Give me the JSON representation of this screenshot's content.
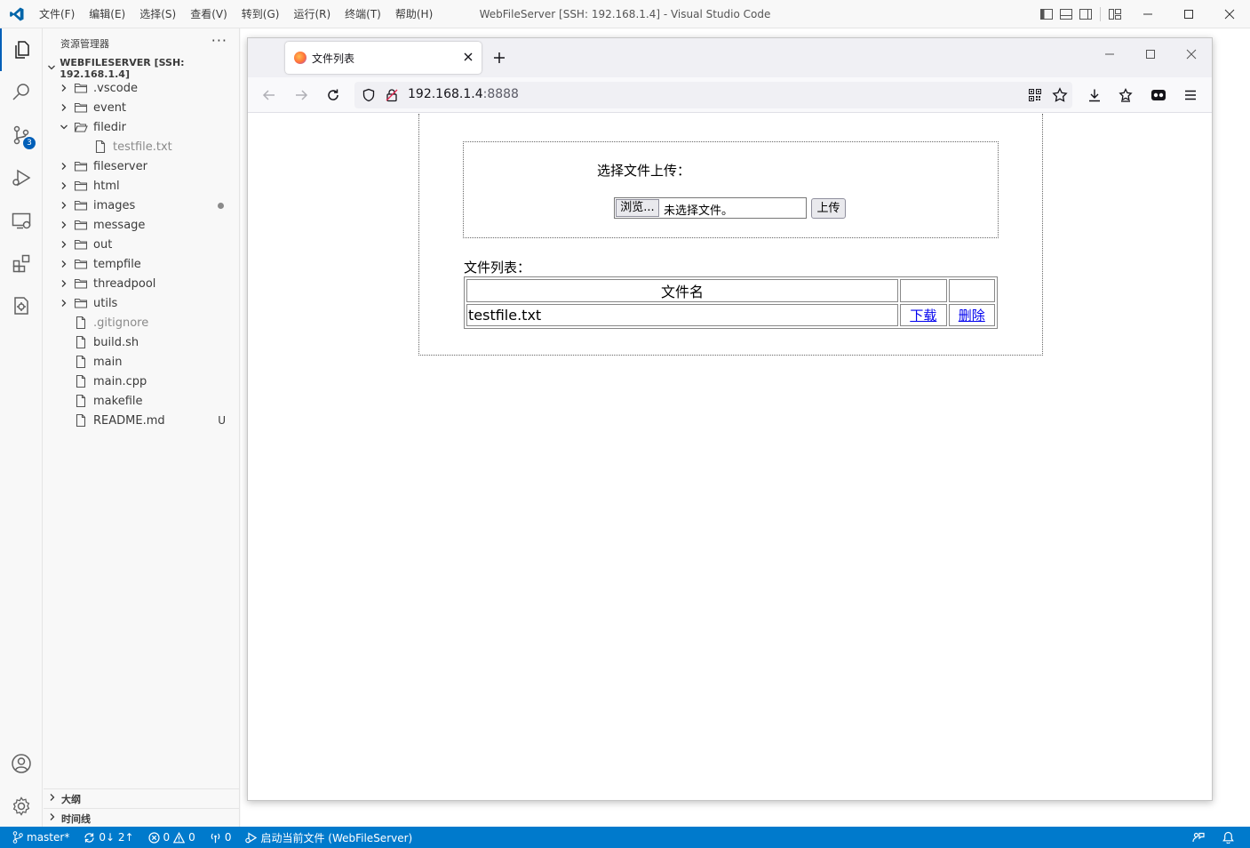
{
  "window": {
    "title": "WebFileServer [SSH: 192.168.1.4] - Visual Studio Code",
    "menu": [
      "文件(F)",
      "编辑(E)",
      "选择(S)",
      "查看(V)",
      "转到(G)",
      "运行(R)",
      "终端(T)",
      "帮助(H)"
    ]
  },
  "activitybar": {
    "items": [
      "files-icon",
      "search-icon",
      "source-control-icon",
      "run-debug-icon",
      "remote-explorer-icon",
      "extensions-icon",
      "testing-icon"
    ],
    "source_control_badge": "3",
    "bottom": [
      "account-icon",
      "settings-gear-icon"
    ]
  },
  "sidebar": {
    "header": "资源管理器",
    "more": "···",
    "section": "WEBFILESERVER [SSH: 192.168.1.4]",
    "tree": [
      {
        "label": ".vscode",
        "type": "folder"
      },
      {
        "label": "event",
        "type": "folder"
      },
      {
        "label": "filedir",
        "type": "folder-open"
      },
      {
        "label": "testfile.txt",
        "type": "file"
      },
      {
        "label": "fileserver",
        "type": "folder"
      },
      {
        "label": "html",
        "type": "folder"
      },
      {
        "label": "images",
        "type": "folder"
      },
      {
        "label": "message",
        "type": "folder"
      },
      {
        "label": "out",
        "type": "folder"
      },
      {
        "label": "tempfile",
        "type": "folder"
      },
      {
        "label": "threadpool",
        "type": "folder"
      },
      {
        "label": "utils",
        "type": "folder"
      },
      {
        "label": ".gitignore",
        "type": "file"
      },
      {
        "label": "build.sh",
        "type": "file"
      },
      {
        "label": "main",
        "type": "file"
      },
      {
        "label": "main.cpp",
        "type": "file"
      },
      {
        "label": "makefile",
        "type": "file"
      },
      {
        "label": "README.md",
        "type": "file",
        "decoration": "U"
      }
    ],
    "outline": "大纲",
    "timeline": "时间线"
  },
  "browser": {
    "tab_title": "文件列表",
    "url_host": "192.168.1.4",
    "url_port": ":8888"
  },
  "webpage": {
    "upload_title": "选择文件上传：",
    "browse_label": "浏览...",
    "no_file_label": "未选择文件。",
    "upload_button": "上传",
    "list_title": "文件列表：",
    "table_header": "文件名",
    "rows": [
      {
        "filename": "testfile.txt",
        "download": "下载",
        "delete": "删除"
      }
    ]
  },
  "statusbar": {
    "branch": "master*",
    "sync": "0↓ 2↑",
    "errors": "0",
    "warnings": "0",
    "ports": "0",
    "launch": "启动当前文件 (WebFileServer)"
  },
  "colors": {
    "accent": "#005fb8",
    "statusbar": "#007acc",
    "link": "#0000ee"
  }
}
